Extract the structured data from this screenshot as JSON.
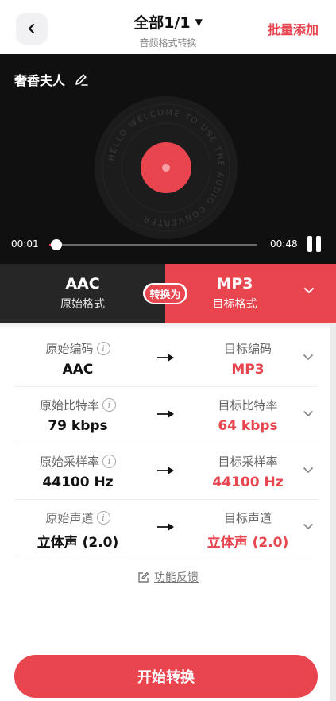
{
  "header": {
    "title": "全部1/1",
    "subtitle": "音频格式转换",
    "batch_add": "批量添加"
  },
  "player": {
    "track_name": "奢香夫人",
    "disc_text": "HELLO WELCOME TO USE THE AUDIO CONVERTER",
    "current_time": "00:01",
    "total_time": "00:48",
    "progress": 0.02
  },
  "format": {
    "source_name": "AAC",
    "source_label": "原始格式",
    "convert_label": "转换为",
    "target_name": "MP3",
    "target_label": "目标格式"
  },
  "details": [
    {
      "left_label": "原始编码",
      "left_value": "AAC",
      "right_label": "目标编码",
      "right_value": "MP3"
    },
    {
      "left_label": "原始比特率",
      "left_value": "79 kbps",
      "right_label": "目标比特率",
      "right_value": "64 kbps"
    },
    {
      "left_label": "原始采样率",
      "left_value": "44100 Hz",
      "right_label": "目标采样率",
      "right_value": "44100 Hz"
    },
    {
      "left_label": "原始声道",
      "left_value": "立体声 (2.0)",
      "right_label": "目标声道",
      "right_value": "立体声 (2.0)"
    }
  ],
  "feedback": "功能反馈",
  "start_button": "开始转换",
  "colors": {
    "accent": "#e8454f",
    "player_bg": "#101010",
    "source_bg": "#262626"
  },
  "icons": {
    "back": "chevron-left-icon",
    "edit": "pencil-icon",
    "pause": "pause-icon",
    "info": "info-icon",
    "arrow": "arrow-right-icon",
    "expand": "chevron-down-icon",
    "feedback": "feedback-icon"
  }
}
